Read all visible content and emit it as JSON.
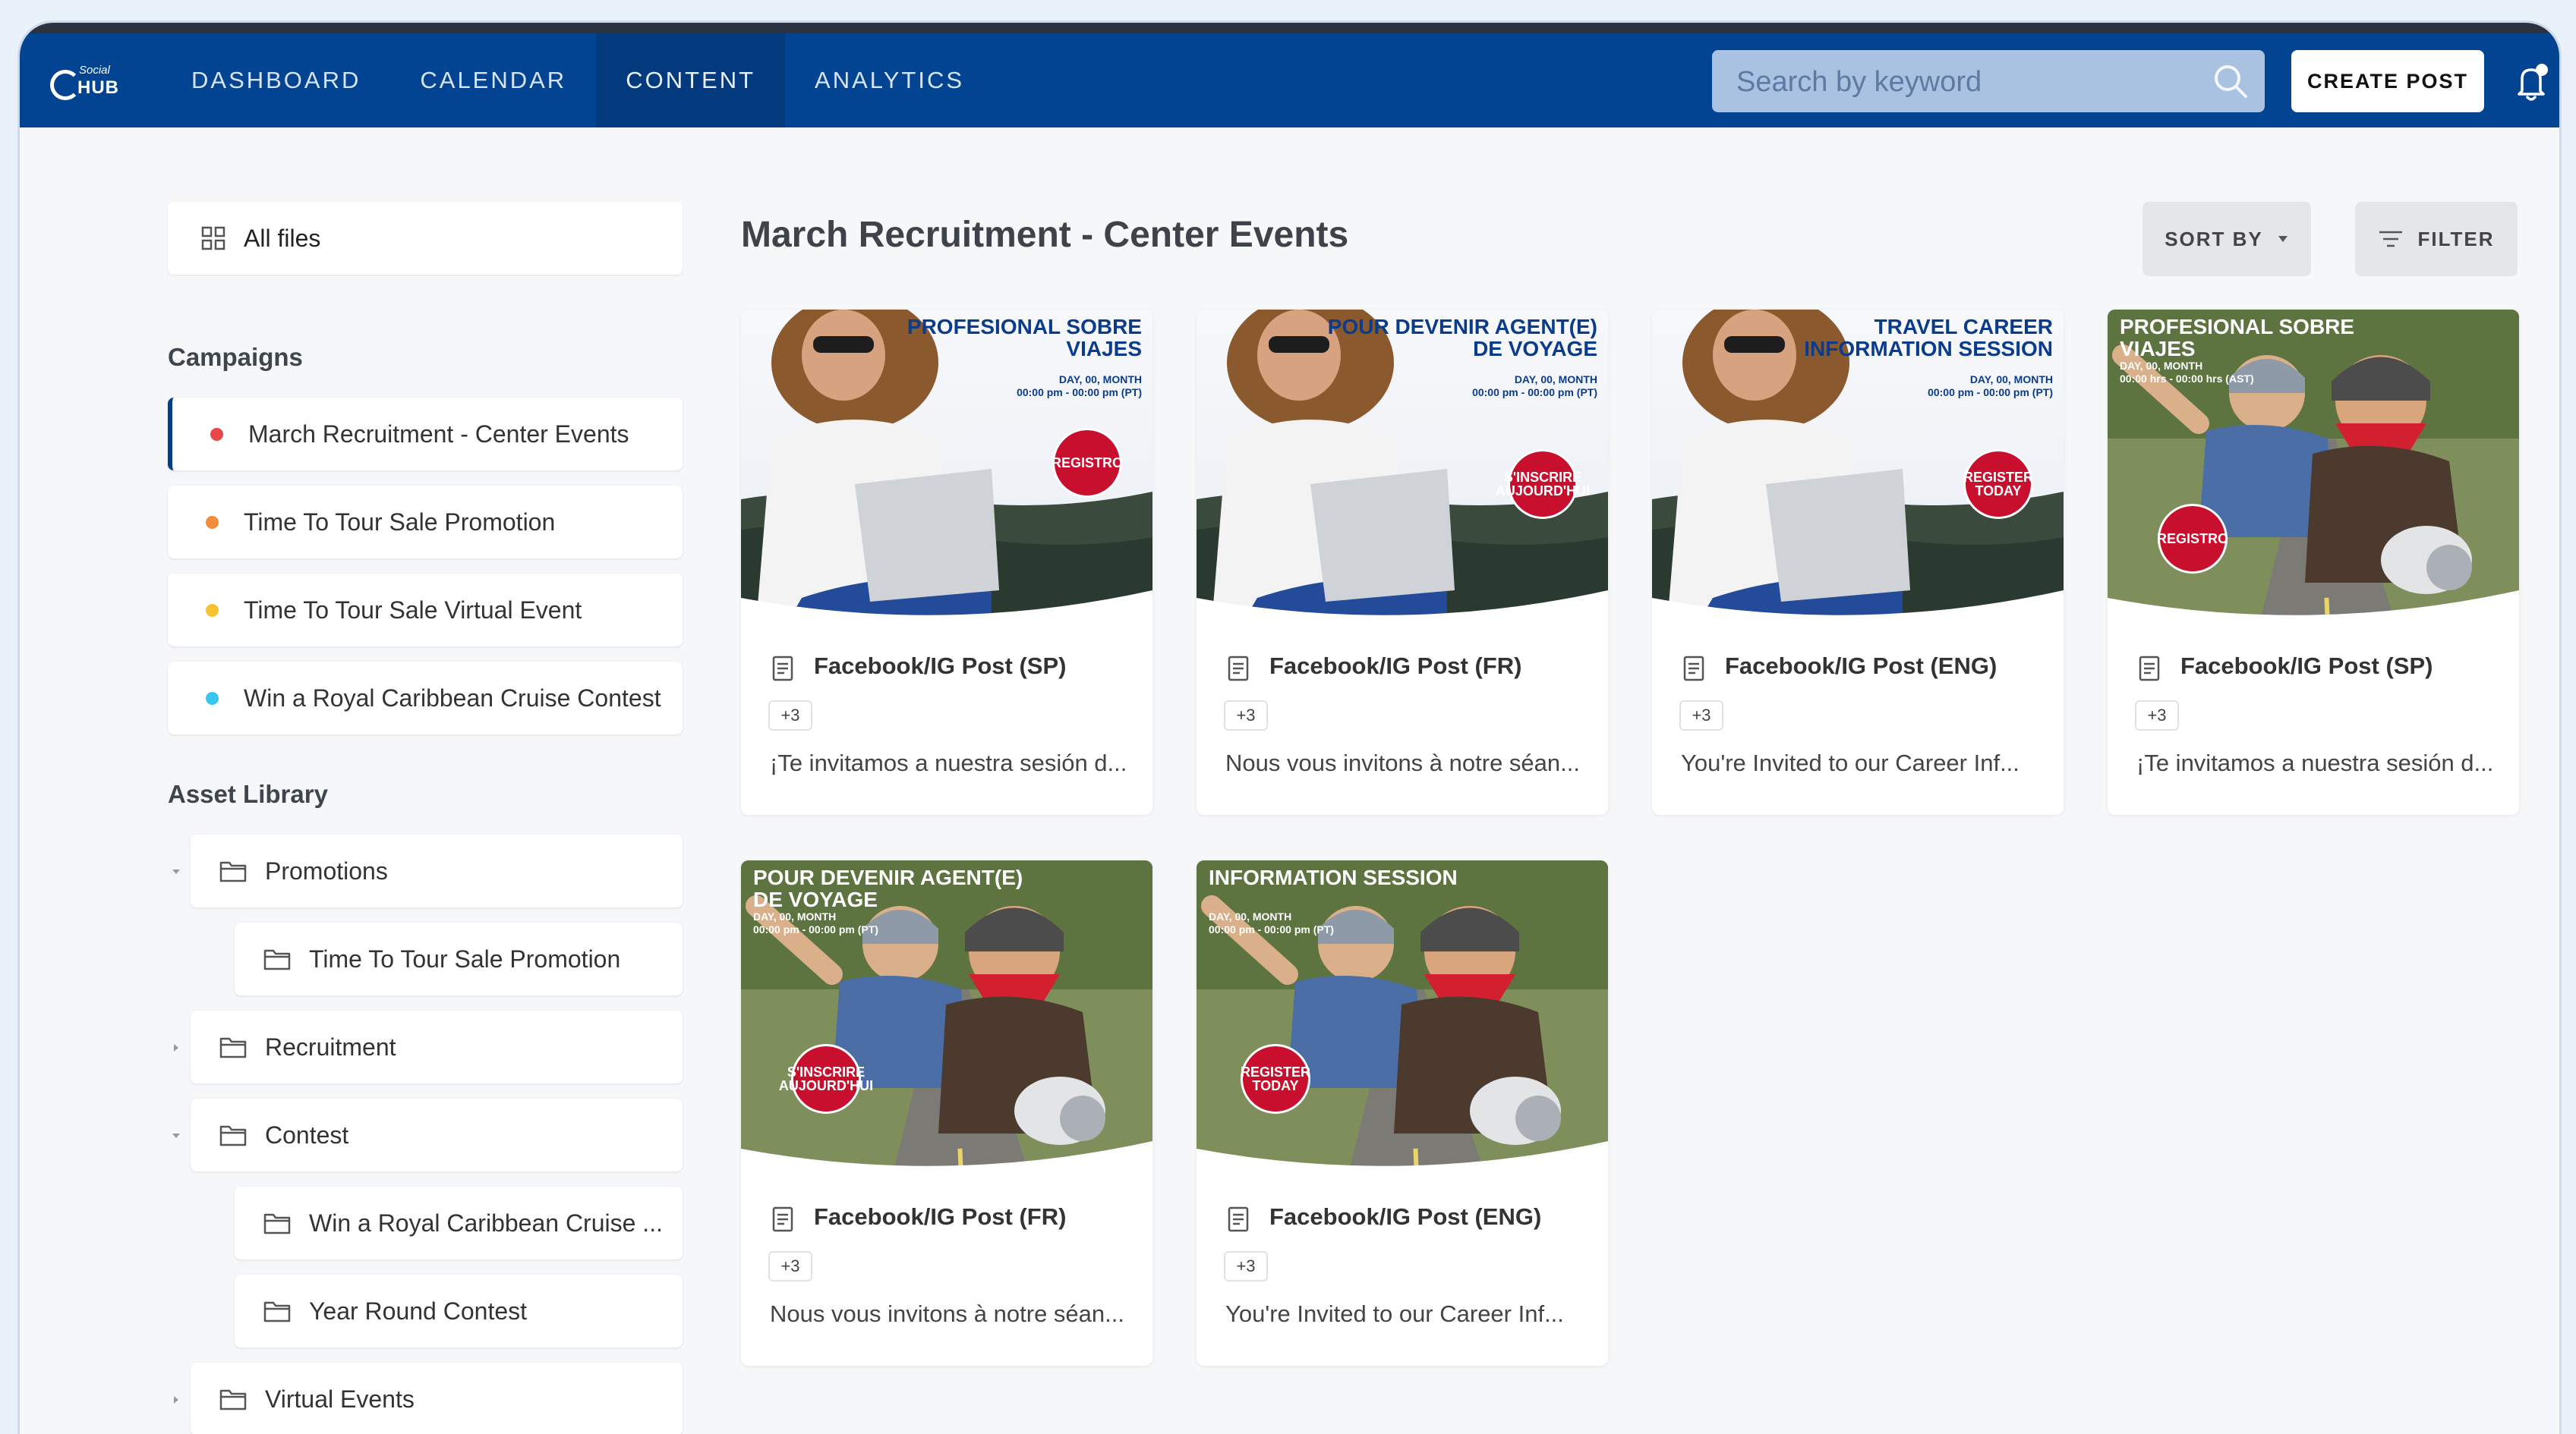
{
  "logo": {
    "line1": "Social",
    "line2": "HUB"
  },
  "nav": [
    {
      "label": "DASHBOARD",
      "active": false
    },
    {
      "label": "CALENDAR",
      "active": false
    },
    {
      "label": "CONTENT",
      "active": true
    },
    {
      "label": "ANALYTICS",
      "active": false
    }
  ],
  "search": {
    "placeholder": "Search by keyword"
  },
  "create_post": "CREATE POST",
  "sidebar": {
    "all_files": "All files",
    "campaigns_title": "Campaigns",
    "campaigns": [
      {
        "label": "March Recruitment - Center Events",
        "color": "#e84848",
        "active": true
      },
      {
        "label": "Time To Tour Sale Promotion",
        "color": "#f28c3b",
        "active": false
      },
      {
        "label": "Time To Tour Sale Virtual Event",
        "color": "#f5c232",
        "active": false
      },
      {
        "label": "Win a Royal Caribbean Cruise Contest",
        "color": "#39c6ee",
        "active": false
      }
    ],
    "asset_library_title": "Asset Library",
    "folders": [
      {
        "label": "Promotions",
        "caret": "down"
      },
      {
        "label": "Time To Tour Sale Promotion",
        "caret": ""
      },
      {
        "label": "Recruitment",
        "caret": "right"
      },
      {
        "label": "Contest",
        "caret": "down"
      },
      {
        "label": "Win a Royal Caribbean Cruise ...",
        "caret": ""
      },
      {
        "label": "Year Round Contest",
        "caret": ""
      },
      {
        "label": "Virtual Events",
        "caret": "right"
      }
    ]
  },
  "main": {
    "title": "March Recruitment - Center Events",
    "sort_by": "SORT BY",
    "filter": "FILTER"
  },
  "cards": [
    {
      "title": "Facebook/IG Post (SP)",
      "count": "+3",
      "excerpt": "¡Te invitamos a nuestra sesión d...",
      "headline": "PROFESIONAL SOBRE VIAJES",
      "sub": "DAY, 00, MONTH\n00:00 pm - 00:00 pm (PT)",
      "badge": "REGISTRO",
      "scene": "laptop"
    },
    {
      "title": "Facebook/IG Post (FR)",
      "count": "+3",
      "excerpt": "Nous vous invitons à notre séan...",
      "headline": "POUR DEVENIR AGENT(E) DE VOYAGE",
      "sub": "DAY, 00, MONTH\n00:00 pm - 00:00 pm (PT)",
      "badge": "S'INSCRIRE AUJOURD'HUI",
      "scene": "laptop"
    },
    {
      "title": "Facebook/IG Post (ENG)",
      "count": "+3",
      "excerpt": "You're Invited to our Career Inf...",
      "headline": "TRAVEL CAREER INFORMATION SESSION",
      "sub": "DAY, 00, MONTH\n00:00 pm - 00:00 pm (PT)",
      "badge": "REGISTER TODAY",
      "scene": "laptop"
    },
    {
      "title": "Facebook/IG Post (SP)",
      "count": "+3",
      "excerpt": "¡Te invitamos a nuestra sesión d...",
      "headline": "PROFESIONAL SOBRE VIAJES",
      "sub": "DAY, 00, MONTH\n00:00 hrs - 00:00 hrs (AST)",
      "badge": "REGISTRO",
      "scene": "scooter"
    },
    {
      "title": "Facebook/IG Post (FR)",
      "count": "+3",
      "excerpt": "Nous vous invitons à notre séan...",
      "headline": "POUR DEVENIR AGENT(E) DE VOYAGE",
      "sub": "DAY, 00, MONTH\n00:00 pm - 00:00 pm (PT)",
      "badge": "S'INSCRIRE AUJOURD'HUI",
      "scene": "scooter"
    },
    {
      "title": "Facebook/IG Post (ENG)",
      "count": "+3",
      "excerpt": "You're Invited to our Career Inf...",
      "headline": "INFORMATION SESSION",
      "sub": "DAY, 00, MONTH\n00:00 pm - 00:00 pm (PT)",
      "badge": "REGISTER TODAY",
      "scene": "scooter"
    }
  ]
}
